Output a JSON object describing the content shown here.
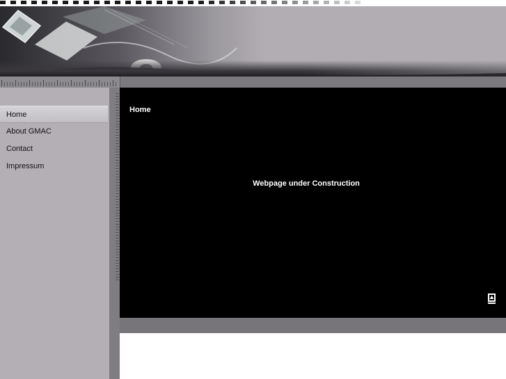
{
  "sidebar": {
    "items": [
      {
        "label": "Home",
        "active": true
      },
      {
        "label": "About GMAC",
        "active": false
      },
      {
        "label": "Contact",
        "active": false
      },
      {
        "label": "Impressum",
        "active": false
      }
    ]
  },
  "main": {
    "title": "Home",
    "message": "Webpage under Construction",
    "back_to_top_icon": "arrow-up-icon"
  },
  "colors": {
    "banner_bg": "#b1adb3",
    "sidebar_bg": "#b3afb5",
    "content_bg": "#000000",
    "bar_gray": "#77757a",
    "text_light": "#ffffff"
  }
}
